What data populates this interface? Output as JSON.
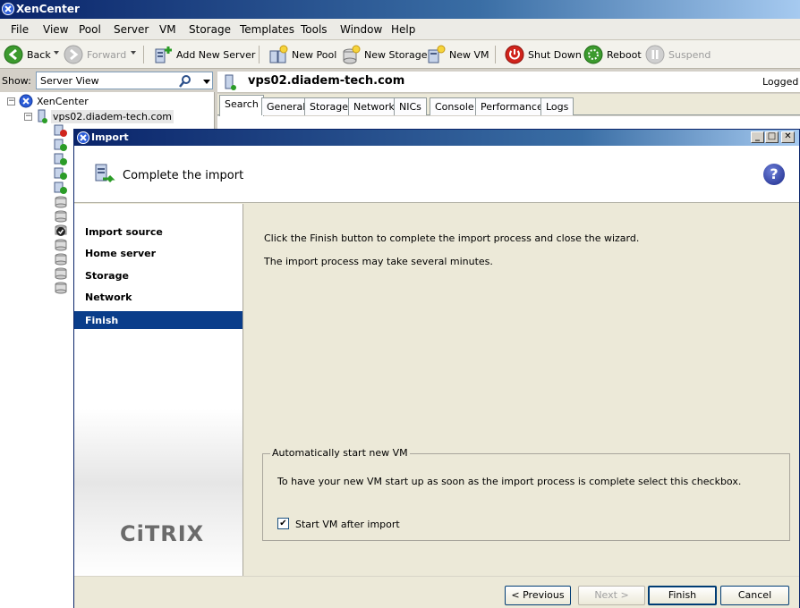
{
  "app": {
    "title": "XenCenter"
  },
  "menu": [
    "File",
    "View",
    "Pool",
    "Server",
    "VM",
    "Storage",
    "Templates",
    "Tools",
    "Window",
    "Help"
  ],
  "toolbar": {
    "back": "Back",
    "forward": "Forward",
    "add_new_server": "Add New Server",
    "new_pool": "New Pool",
    "new_storage": "New Storage",
    "new_vm": "New VM",
    "shut_down": "Shut Down",
    "reboot": "Reboot",
    "suspend": "Suspend"
  },
  "left_pane": {
    "show_label": "Show:",
    "view_value": "Server View",
    "tree": {
      "root": "XenCenter",
      "server": "vps02.diadem-tech.com"
    }
  },
  "right_pane": {
    "server_title": "vps02.diadem-tech.com",
    "logged_in": "Logged in",
    "tabs": [
      "Search",
      "General",
      "Storage",
      "Network",
      "NICs",
      "Console",
      "Performance",
      "Logs"
    ],
    "active_tab": "Search"
  },
  "dialog": {
    "title": "Import",
    "header_title": "Complete the import",
    "help_symbol": "?",
    "nav": [
      "Import source",
      "Home server",
      "Storage",
      "Network",
      "Finish"
    ],
    "active_step": "Finish",
    "logo": "CiTRIX",
    "content_line1": "Click the Finish button to complete the import process and close the wizard.",
    "content_line2": "The import process may take several minutes.",
    "group_title": "Automatically start new VM",
    "group_desc": "To have your new VM start up as soon as the import process is complete select this checkbox.",
    "checkbox_label": "Start VM after import",
    "checkbox_checked": true,
    "buttons": {
      "previous": "< Previous",
      "next": "Next >",
      "finish": "Finish",
      "cancel": "Cancel"
    }
  },
  "colors": {
    "titlebar": "#0a246a",
    "nav_active": "#0a3d8a",
    "dialog_bg": "#ece9d8"
  }
}
